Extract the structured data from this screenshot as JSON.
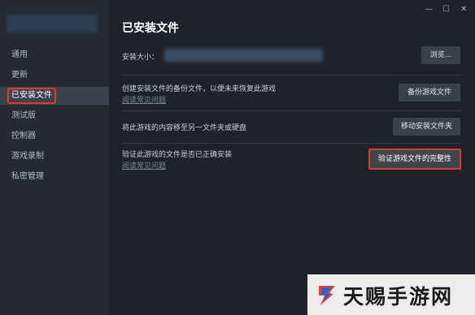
{
  "sidebar": {
    "items": [
      {
        "label": "通用"
      },
      {
        "label": "更新"
      },
      {
        "label": "已安装文件",
        "active": true
      },
      {
        "label": "测试版"
      },
      {
        "label": "控制器"
      },
      {
        "label": "游戏录制"
      },
      {
        "label": "私密管理"
      }
    ]
  },
  "window_controls": {
    "minimize": "—",
    "maximize": "☐",
    "close": "✕"
  },
  "main": {
    "title": "已安装文件",
    "install_size_label": "安装大小：",
    "browse_button": "浏览...",
    "backup": {
      "text": "创建安装文件的备份文件，以便未来恢复此游戏",
      "link": "阅读常见问题",
      "button": "备份游戏文件"
    },
    "move": {
      "text": "将此游戏的内容移至另一文件夹或硬盘",
      "button": "移动安装文件夹"
    },
    "verify": {
      "text": "验证此游戏的文件是否已正确安装",
      "link": "阅读常见问题",
      "button": "验证游戏文件的完整性"
    }
  },
  "watermark": {
    "text": "天赐手游网"
  },
  "colors": {
    "highlight": "#d93a3a",
    "background": "#1e232a",
    "sidebar": "#252a31"
  }
}
